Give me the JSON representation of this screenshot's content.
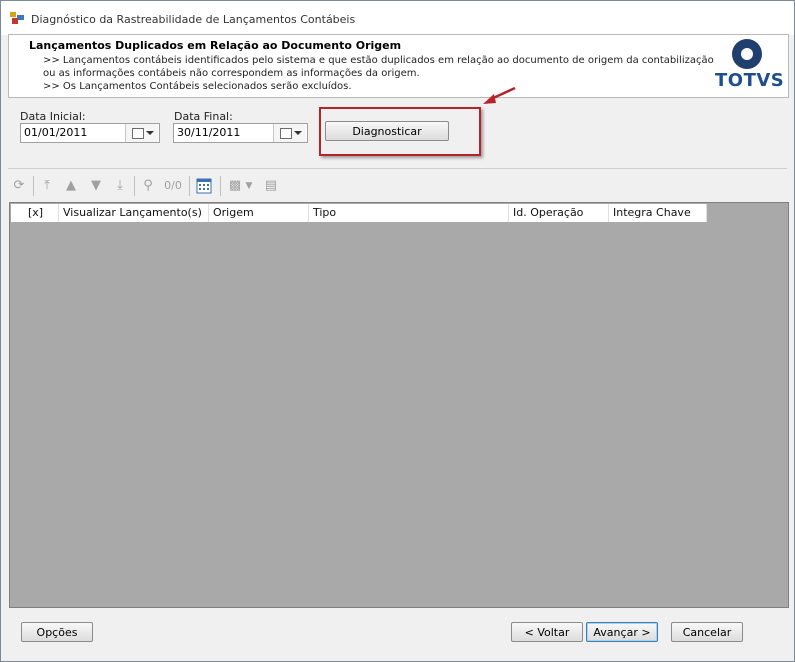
{
  "window": {
    "title": "Diagnóstico da Rastreabilidade de Lançamentos Contábeis"
  },
  "header": {
    "title": "Lançamentos Duplicados em Relação ao Documento Origem",
    "lines": [
      ">>  Lançamentos contábeis identificados pelo sistema e que estão duplicados em relação ao documento de origem da contabilização",
      "ou as informações contábeis não correspondem as informações da origem.",
      ">> Os Lançamentos Contábeis selecionados serão excluídos."
    ],
    "logo_text": "TOTVS"
  },
  "params": {
    "start_label": "Data Inicial:",
    "start_value": "01/01/2011",
    "end_label": "Data Final:",
    "end_value": "30/11/2011",
    "diagnose_label": "Diagnosticar"
  },
  "toolbar": {
    "counter": "0/0"
  },
  "grid": {
    "columns": [
      "[x]",
      "Visualizar Lançamento(s)",
      "Origem",
      "Tipo",
      "Id. Operação",
      "Integra Chave"
    ]
  },
  "footer": {
    "options_label": "Opções",
    "back_label": "< Voltar",
    "next_label": "Avançar >",
    "cancel_label": "Cancelar"
  },
  "colors": {
    "highlight": "#b5242b",
    "grid_bg": "#a9a9a9",
    "logo_blue": "#1f4e8c"
  }
}
